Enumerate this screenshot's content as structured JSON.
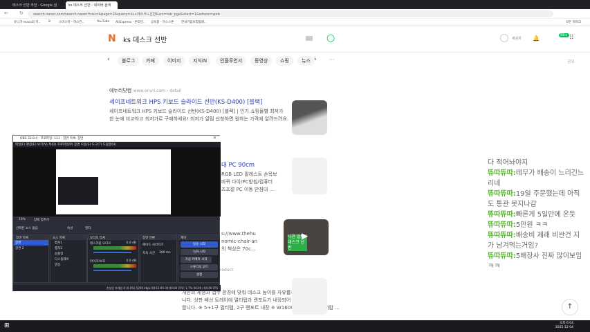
{
  "browser": {
    "tabs": [
      {
        "label": "데스크 선반 추천 - Google 검"
      },
      {
        "label": "ks 데스크 선반 : 네이버 검색"
      }
    ],
    "url": "search.naver.com/search.naver?nso=&page=2&query=ks+데스크+선반&sm=tab_pge&start=1&where=web",
    "bookmarks": [
      "유니가 macs의 치..",
      "8",
      "스마스마 - 하스킨..",
      "YouTube",
      "AliExpress - 온라인..",
      "공육봉 - 하스스톤",
      "한국기업보험협회.."
    ],
    "all_bookmarks": "모든 북마크"
  },
  "naver": {
    "logo": "N",
    "query": "ks 데스크 선반",
    "user": "새김하",
    "mail_badge": "99+",
    "nav_tabs": [
      "블로그",
      "카페",
      "이미지",
      "지식iN",
      "인플루언서",
      "동영상",
      "쇼핑",
      "뉴스"
    ],
    "more": "···",
    "share": "공유"
  },
  "results": [
    {
      "source": "에누리닷컴",
      "url": "www.enuri.com › detail",
      "title": "세이프네트워크 HPS 키보드 슬라이드 선반(KS-D400) [블랙]",
      "desc": "세이프네트워크 HPS 키보드 슬라이드 선반(KS-D400) [블랙] | 인기 쇼핑몰별 최저가 한 눈에 비교하고 최저가로 구매하세요! 최저가 알림 신청하면 원하는 가격에 알려드려요."
    },
    {
      "title": "대 PC 90cm",
      "desc": [
        "RGB LED 팔레스트 손목보",
        "바퀴 다이/PC받침/컴퓨터",
        "즈조절 PC 이동 받침대 ..."
      ]
    },
    {
      "desc": [
        "s://www.thehu",
        "nomic-chair-an",
        "의 책상은 70c..."
      ],
      "video_caption": "나만 알던 데스크 선반"
    },
    {
      "url": "roduct",
      "desc": [
        "개인의 체형과 업무 환경에 맞춰 데스크 높이를 자유롭게 조절할 수 있습",
        "니다. 상판 배선 트레이에 멀티탭과 랜포트가 내장되어 있어 사용이 편리",
        "합니다. ※ 5+1구 멀티탭, 2구 랜포트 내장 ※ W1600, W1800 평잉서랍 ..."
      ]
    }
  ],
  "chat": {
    "partial": "다 적어놔야지",
    "messages": [
      {
        "nick": "뜌따뜌따:",
        "text": "테무가 배송이 느리긴느리네"
      },
      {
        "nick": "뜌따뜌따:",
        "text": "19일 주문했는데 아직도 통관 못지나감"
      },
      {
        "nick": "뜌따뜌따:",
        "text": "빠른게 5일만에 온듯"
      },
      {
        "nick": "뜌따뜌따:",
        "text": "5만원 ㅋㅋ"
      },
      {
        "nick": "뜌따뜌따:",
        "text": "배송비 제래 비싼건 지가 남겨먹는거임?"
      },
      {
        "nick": "뜌따뜌따:",
        "text": "5배장사 진짜 많이보임 ㅋㅋ"
      }
    ]
  },
  "obs": {
    "title": "OBS 32.0.4 - 프로파일: 111 - 장면 목록: 장면",
    "menu": [
      "파일(F)",
      "편집(E)",
      "보기(V)",
      "독(D)",
      "프로파일(P)",
      "장면 모음(S)",
      "도구(T)",
      "도움말(H)"
    ],
    "zoom": "19%",
    "mode": "창에 맞추기",
    "selected_source": "선택된 소스 없음",
    "props": "속성",
    "filters": "필터",
    "docks": {
      "scenes": "장면 목록",
      "sources": "소스 목록",
      "mixer": "오디오 믹서",
      "transitions": "장면 전환",
      "controls": "제어"
    },
    "scenes": [
      "장면",
      "장면 2"
    ],
    "sources": [
      "캡처1",
      "캡처2",
      "음향장",
      "디스플레이",
      "영상"
    ],
    "mixer": [
      {
        "name": "데스크탑 오디오",
        "db": "0.0 dB"
      },
      {
        "name": "마이크/보조",
        "db": "0.0 dB"
      }
    ],
    "transition": "페이드 사라지기",
    "duration_label": "지속 시간",
    "duration": "300 ms",
    "controls": [
      "방송 시작",
      "녹화 시작",
      "가상 카메라 시작",
      "스튜디오 모드",
      "설정"
    ],
    "status": "손실된 프레임 0 (0.0%)   5290 kbps   00:12:05   00:00:00   CPU: 1.7%   60.00 / 60.00 FPS"
  },
  "taskbar": {
    "time": "오후 6:04",
    "date": "2025-12-04"
  }
}
